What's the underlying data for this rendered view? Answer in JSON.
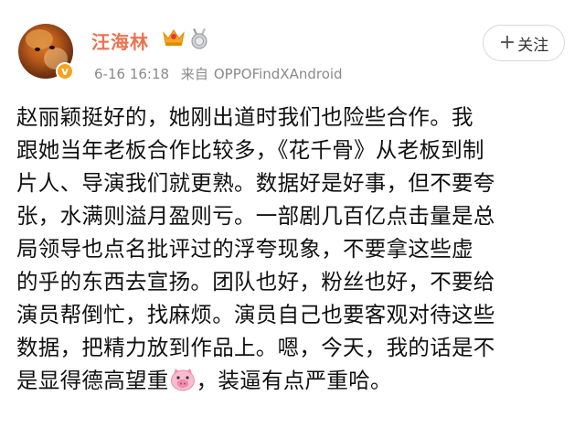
{
  "post": {
    "username": "汪海林",
    "date": "6-16",
    "time": "16:18",
    "source_label": "来自",
    "device": "OPPOFindXAndroid",
    "follow_label": "关注",
    "follow_plus": "+",
    "verified_badge": "v",
    "icons": [
      "crown-icon",
      "medal-icon",
      "pig-face-icon"
    ],
    "body_lines": [
      "赵丽颖挺好的，她刚出道时我们也险些合作。我",
      "跟她当年老板合作比较多，《花千骨》从老板到制",
      "片人、导演我们就更熟。数据好是好事，但不要夸",
      "张，水满则溢月盈则亏。一部剧几百亿点击量是总",
      "局领导也点名批评过的浮夸现象，不要拿这些虚",
      "的乎的东西去宣扬。团队也好，粉丝也好，不要给",
      "演员帮倒忙，找麻烦。演员自己也要客观对待这些",
      "数据，把精力放到作品上。嗯，今天，我的话是不"
    ],
    "last_line_before_emoji": "是显得德高望重",
    "last_line_after_emoji": "，装逼有点严重哈。",
    "colors": {
      "username": "#eb7350",
      "meta": "#8a8a8a",
      "badge": "#f7a321"
    }
  }
}
